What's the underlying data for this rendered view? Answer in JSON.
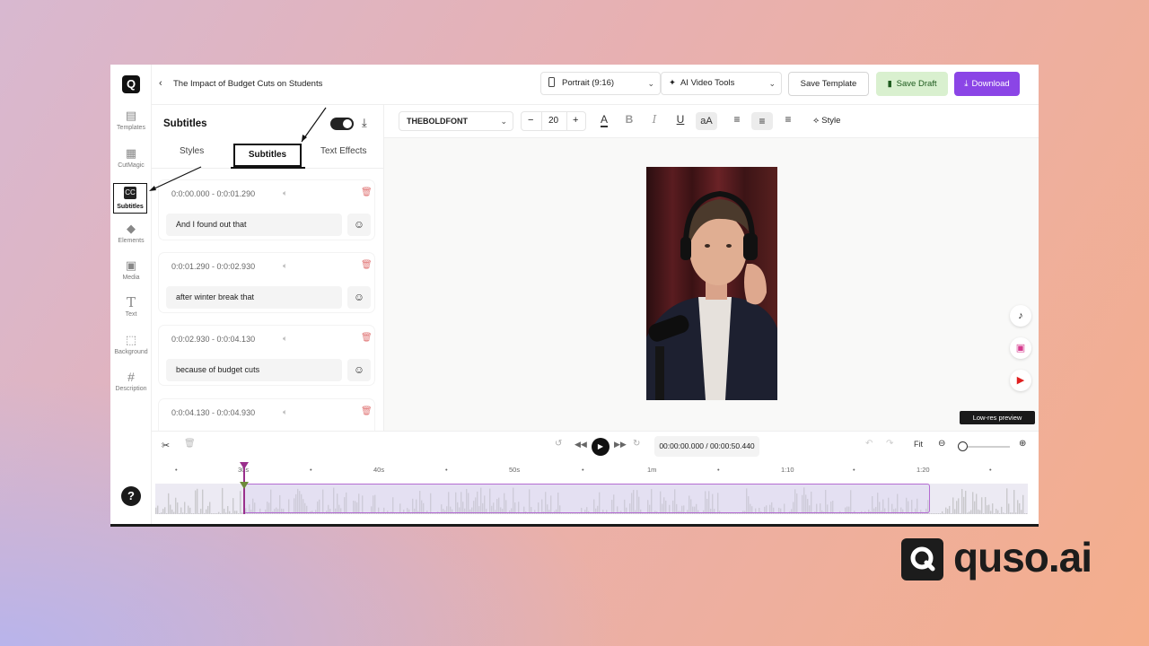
{
  "app": {
    "doc_title": "The Impact of Budget Cuts on Students",
    "aspect_select": "Portrait (9:16)",
    "ai_tools_select": "AI Video Tools",
    "save_template": "Save Template",
    "save_draft": "Save Draft",
    "download": "Download"
  },
  "rail": {
    "items": [
      {
        "label": "Templates",
        "icon": "templates-icon"
      },
      {
        "label": "CutMagic",
        "icon": "clapper-icon"
      },
      {
        "label": "Subtitles",
        "icon": "cc-icon",
        "glyph": "CC"
      },
      {
        "label": "Elements",
        "icon": "shapes-icon"
      },
      {
        "label": "Media",
        "icon": "image-icon"
      },
      {
        "label": "Text",
        "icon": "text-icon",
        "glyph": "T"
      },
      {
        "label": "Background",
        "icon": "background-icon"
      },
      {
        "label": "Description",
        "icon": "hash-icon",
        "glyph": "#"
      }
    ],
    "help": "?"
  },
  "panel": {
    "title": "Subtitles",
    "tabs": [
      "Styles",
      "Subtitles",
      "Text Effects"
    ],
    "segments": [
      {
        "time": "0:0:00.000 - 0:0:01.290",
        "text": "And I found out that"
      },
      {
        "time": "0:0:01.290 - 0:0:02.930",
        "text": "after winter break that"
      },
      {
        "time": "0:0:02.930 - 0:0:04.130",
        "text": "because of budget cuts"
      },
      {
        "time": "0:0:04.130 - 0:0:04.930",
        "text": ""
      }
    ]
  },
  "format": {
    "font": "THEBOLDFONT",
    "size": "20",
    "minus": "−",
    "plus": "+",
    "style": "Style",
    "case": "aA"
  },
  "canvas": {
    "lowres": "Low-res preview",
    "socials": [
      "tiktok-icon",
      "reels-icon",
      "shorts-icon"
    ]
  },
  "timeline": {
    "timecode": "00:00:00.000 / 00:00:50.440",
    "fit": "Fit",
    "ticks": [
      "30s",
      "40s",
      "50s",
      "1m",
      "1:10",
      "1:20"
    ]
  },
  "brand": {
    "name": "quso.ai"
  }
}
